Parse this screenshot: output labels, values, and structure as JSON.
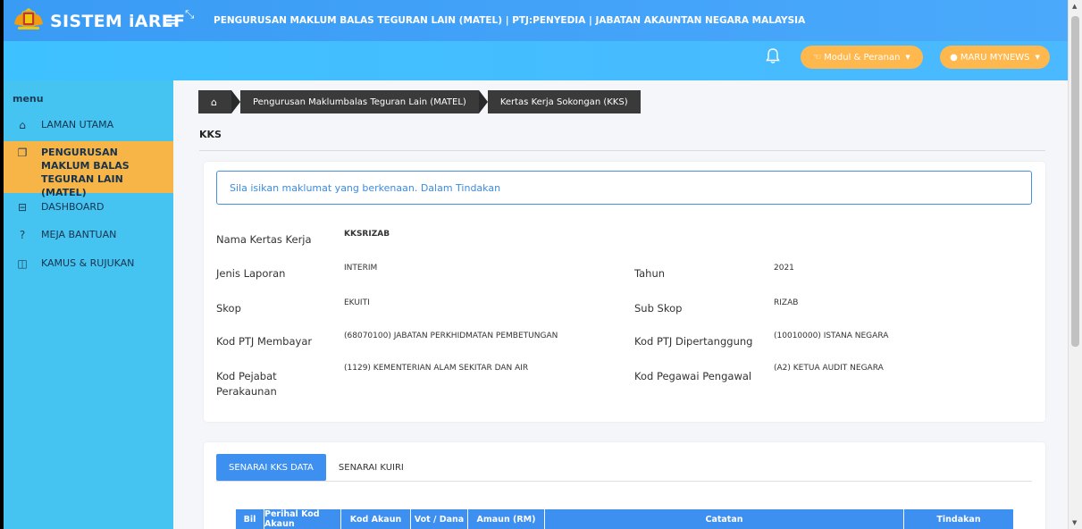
{
  "header": {
    "app_title": "SISTEM iAREF",
    "menu_glyph": "≡",
    "expand_glyph": "⤡",
    "page_heading": "PENGURUSAN MAKLUM BALAS TEGURAN LAIN (MATEL) | PTJ:PENYEDIA | JABATAN AKAUNTAN NEGARA MALAYSIA",
    "modul_button": "Modul & Peranan",
    "user_button": "MARU MYNEWS"
  },
  "sidebar": {
    "heading": "menu",
    "items": [
      {
        "label": "LAMAN UTAMA",
        "icon": "home-icon"
      },
      {
        "label": "PENGURUSAN MAKLUM BALAS TEGURAN LAIN (MATEL)",
        "icon": "window-icon"
      },
      {
        "label": "DASHBOARD",
        "icon": "dashboard-icon"
      },
      {
        "label": "MEJA BANTUAN",
        "icon": "question-icon"
      },
      {
        "label": "KAMUS & RUJUKAN",
        "icon": "book-icon"
      }
    ]
  },
  "breadcrumb": {
    "items": [
      "Pengurusan Maklumbalas Teguran Lain (MATEL)",
      "Kertas Kerja Sokongan (KKS)"
    ]
  },
  "page": {
    "title": "KKS",
    "notice": "Sila isikan maklumat yang berkenaan. Dalam Tindakan"
  },
  "form": {
    "nama_kertas_kerja": {
      "label": "Nama Kertas Kerja",
      "value": "KKSRIZAB"
    },
    "jenis_laporan": {
      "label": "Jenis Laporan",
      "value": "INTERIM"
    },
    "tahun": {
      "label": "Tahun",
      "value": "2021"
    },
    "skop": {
      "label": "Skop",
      "value": "EKUITI"
    },
    "sub_skop": {
      "label": "Sub Skop",
      "value": "RIZAB"
    },
    "kod_ptj_membayar": {
      "label": "Kod PTJ Membayar",
      "value": "(68070100) JABATAN PERKHIDMATAN PEMBETUNGAN"
    },
    "kod_ptj_dipertanggung": {
      "label": "Kod PTJ Dipertanggung",
      "value": "(10010000) ISTANA NEGARA"
    },
    "kod_pejabat_perakaunan": {
      "label_line1": "Kod Pejabat",
      "label_line2": "Perakaunan",
      "value": "(1129) KEMENTERIAN ALAM SEKITAR DAN AIR"
    },
    "kod_pegawai_pengawal": {
      "label": "Kod Pegawai Pengawal",
      "value": "(A2) KETUA AUDIT NEGARA"
    }
  },
  "tabs": [
    "SENARAI KKS DATA",
    "SENARAI KUIRI"
  ],
  "table": {
    "columns": [
      "Bil",
      "Perihal Kod Akaun",
      "Kod Akaun",
      "Vot / Dana",
      "Amaun (RM)",
      "Catatan",
      "Tindakan"
    ]
  },
  "colors": {
    "header_blue": "#3a9bf5",
    "sidebar_cyan": "#45c4f2",
    "active_orange": "#f7b547",
    "button_orange": "#ffb84d",
    "primary_blue": "#3d8ff0"
  }
}
